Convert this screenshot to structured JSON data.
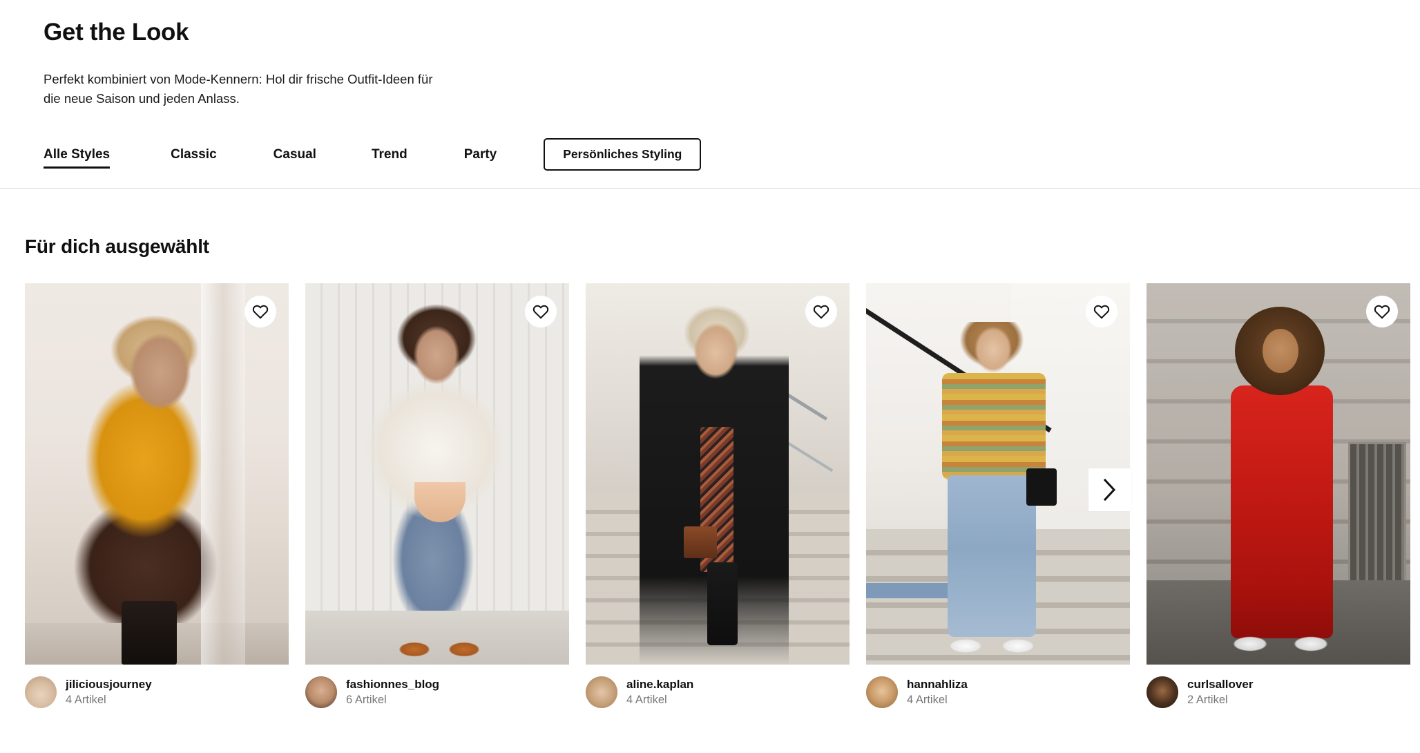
{
  "hero": {
    "title": "Get the Look",
    "subtitle": "Perfekt kombiniert von Mode-Kennern: Hol dir frische Outfit-Ideen für die neue Saison und jeden Anlass."
  },
  "tabs": [
    {
      "label": "Alle Styles",
      "active": true
    },
    {
      "label": "Classic",
      "active": false
    },
    {
      "label": "Casual",
      "active": false
    },
    {
      "label": "Trend",
      "active": false
    },
    {
      "label": "Party",
      "active": false
    }
  ],
  "styling_button": {
    "label": "Persönliches Styling"
  },
  "section": {
    "title": "Für dich ausgewählt"
  },
  "cards": [
    {
      "username": "jiliciousjourney",
      "items": "4 Artikel",
      "like_icon": "heart-icon"
    },
    {
      "username": "fashionnes_blog",
      "items": "6 Artikel",
      "like_icon": "heart-icon"
    },
    {
      "username": "aline.kaplan",
      "items": "4 Artikel",
      "like_icon": "heart-icon"
    },
    {
      "username": "hannahliza",
      "items": "4 Artikel",
      "like_icon": "heart-icon"
    },
    {
      "username": "curlsallover",
      "items": "2 Artikel",
      "like_icon": "heart-icon"
    }
  ],
  "carousel": {
    "next_icon": "chevron-right-icon"
  },
  "colors": {
    "text": "#101010",
    "muted": "#767676",
    "divider": "#dcdcdc",
    "background": "#ffffff"
  }
}
